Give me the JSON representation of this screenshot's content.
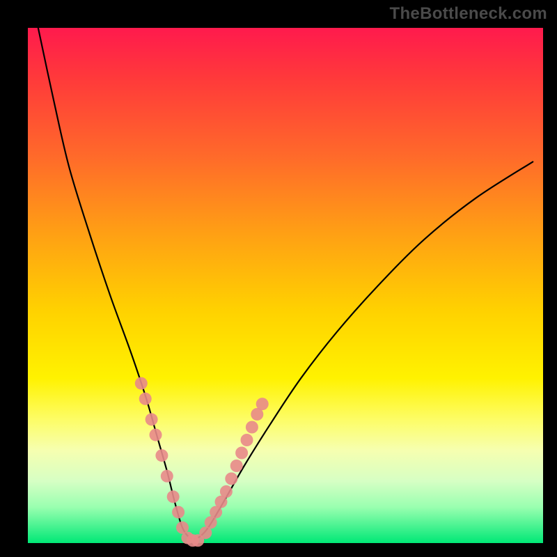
{
  "watermark": "TheBottleneck.com",
  "colors": {
    "curve": "#000000",
    "dots": "#e88a8a",
    "background": "#000000"
  },
  "chart_data": {
    "type": "line",
    "title": "",
    "xlabel": "",
    "ylabel": "",
    "xlim": [
      0,
      100
    ],
    "ylim": [
      0,
      100
    ],
    "grid": false,
    "legend": false,
    "series": [
      {
        "name": "bottleneck-curve",
        "x": [
          2,
          5,
          8,
          12,
          16,
          20,
          23,
          25,
          27,
          28.5,
          30,
          31.5,
          33,
          35,
          38,
          42,
          47,
          53,
          60,
          68,
          77,
          87,
          98
        ],
        "y": [
          100,
          86,
          73,
          60,
          48,
          37,
          28,
          21,
          14,
          8,
          3,
          1,
          1,
          3,
          8,
          15,
          23,
          32,
          41,
          50,
          59,
          67,
          74
        ]
      }
    ],
    "marker_clusters": [
      {
        "name": "left-segment-dots",
        "points": [
          {
            "x": 22.0,
            "y": 31
          },
          {
            "x": 22.8,
            "y": 28
          },
          {
            "x": 24.0,
            "y": 24
          },
          {
            "x": 24.8,
            "y": 21
          },
          {
            "x": 26.0,
            "y": 17
          },
          {
            "x": 27.0,
            "y": 13
          },
          {
            "x": 28.2,
            "y": 9
          },
          {
            "x": 29.2,
            "y": 6
          },
          {
            "x": 30.0,
            "y": 3
          },
          {
            "x": 31.0,
            "y": 1
          },
          {
            "x": 32.0,
            "y": 0.5
          },
          {
            "x": 33.0,
            "y": 0.5
          }
        ]
      },
      {
        "name": "right-segment-dots",
        "points": [
          {
            "x": 34.5,
            "y": 2
          },
          {
            "x": 35.5,
            "y": 4
          },
          {
            "x": 36.5,
            "y": 6
          },
          {
            "x": 37.5,
            "y": 8
          },
          {
            "x": 38.5,
            "y": 10
          },
          {
            "x": 39.5,
            "y": 12.5
          },
          {
            "x": 40.5,
            "y": 15
          },
          {
            "x": 41.5,
            "y": 17.5
          },
          {
            "x": 42.5,
            "y": 20
          },
          {
            "x": 43.5,
            "y": 22.5
          },
          {
            "x": 44.5,
            "y": 25
          },
          {
            "x": 45.5,
            "y": 27
          }
        ]
      }
    ]
  }
}
